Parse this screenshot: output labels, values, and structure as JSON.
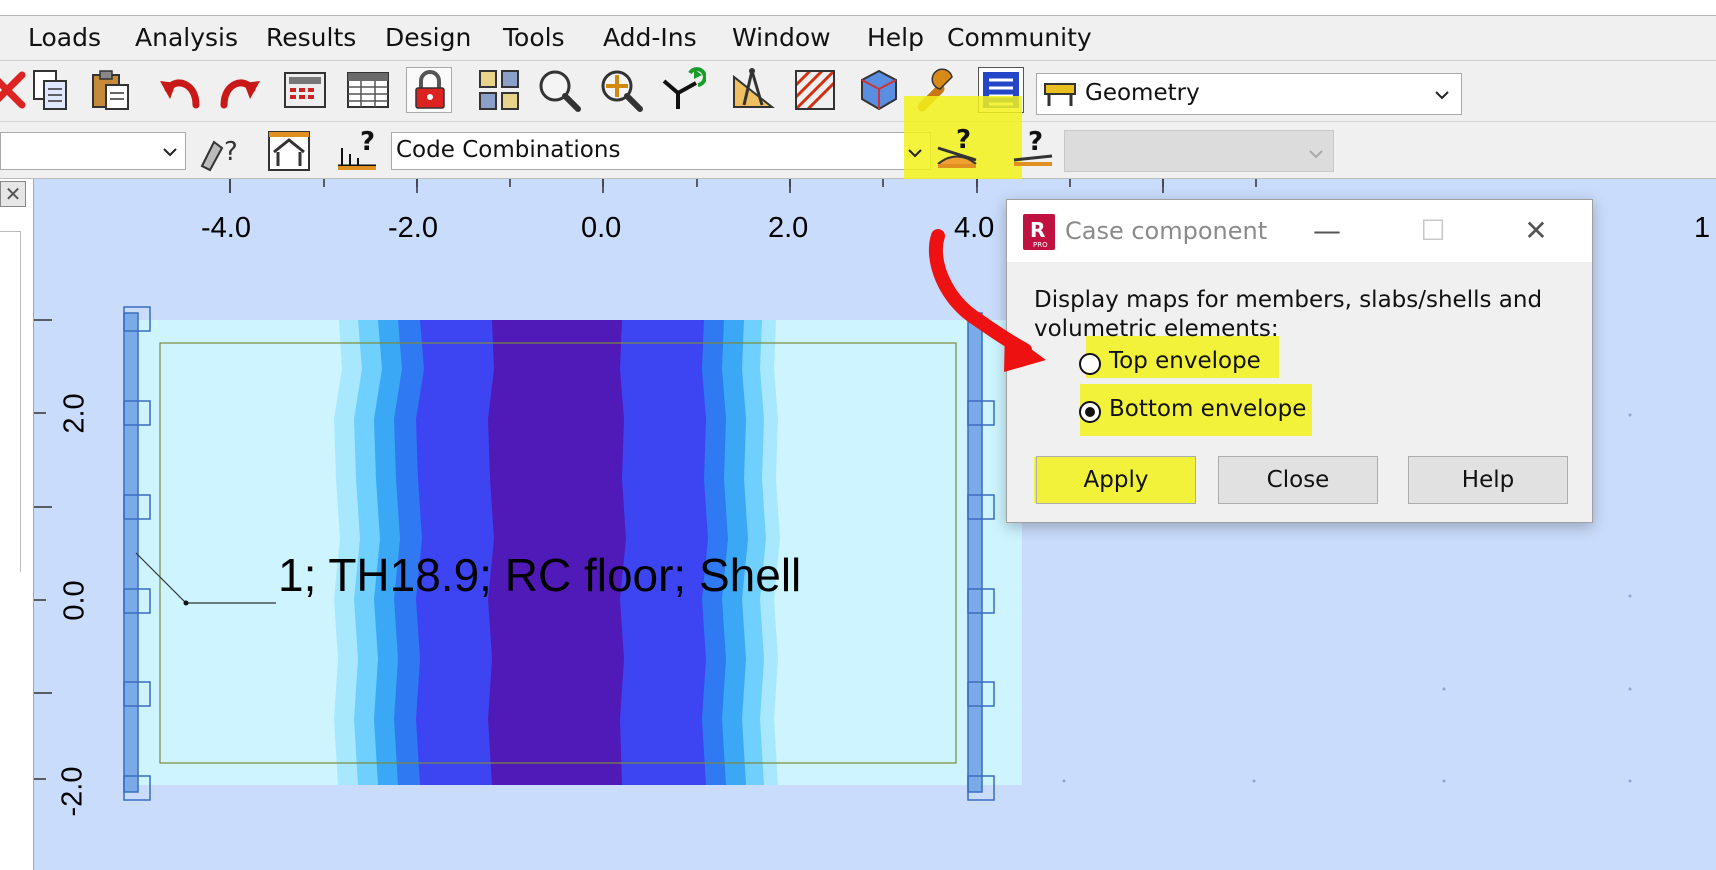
{
  "menubar": {
    "items": [
      "Loads",
      "Analysis",
      "Results",
      "Design",
      "Tools",
      "Add-Ins",
      "Window",
      "Help",
      "Community"
    ]
  },
  "toolbar": {
    "icons": [
      "delete-icon",
      "copy-icon",
      "paste-icon",
      "undo-icon",
      "redo-icon",
      "calculator-icon",
      "tables-icon",
      "lock-icon",
      "section-icon",
      "zoom-icon",
      "pan-icon",
      "supports-icon",
      "dimension-icon",
      "hatch-icon",
      "structure-3d-icon",
      "wrench-icon",
      "view-list-icon"
    ],
    "layout_combo": {
      "value": "Geometry"
    }
  },
  "toolbar2": {
    "code_combo": {
      "value": "Code Combinations"
    },
    "disabled_combo": {
      "value": ""
    }
  },
  "canvas": {
    "x_ticks": [
      "-4.0",
      "-2.0",
      "0.0",
      "2.0",
      "4.0",
      "1"
    ],
    "y_ticks": [
      "2.0",
      "0.0",
      "-2.0"
    ],
    "shell_label": "1; TH18.9; RC floor; Shell",
    "colors": {
      "background": "#c9dcfb",
      "band_1": "#cdf4ff",
      "band_2": "#a8e8ff",
      "band_3": "#6fcffd",
      "band_4": "#3aa8f5",
      "band_5": "#2f79f2",
      "band_6": "#3d45f3",
      "band_7": "#4f1ab8"
    }
  },
  "dialog": {
    "title": "Case component",
    "description": "Display maps for members, slabs/shells and volumetric elements:",
    "options": [
      {
        "label": "Top envelope",
        "checked": false
      },
      {
        "label": "Bottom envelope",
        "checked": true
      }
    ],
    "buttons": {
      "apply": "Apply",
      "close": "Close",
      "help": "Help"
    },
    "controls": {
      "minimize": "—",
      "maximize": "☐",
      "close": "✕"
    }
  },
  "annotation": {
    "highlight_color": "#f2f21a",
    "arrow_color": "#ee1111"
  }
}
